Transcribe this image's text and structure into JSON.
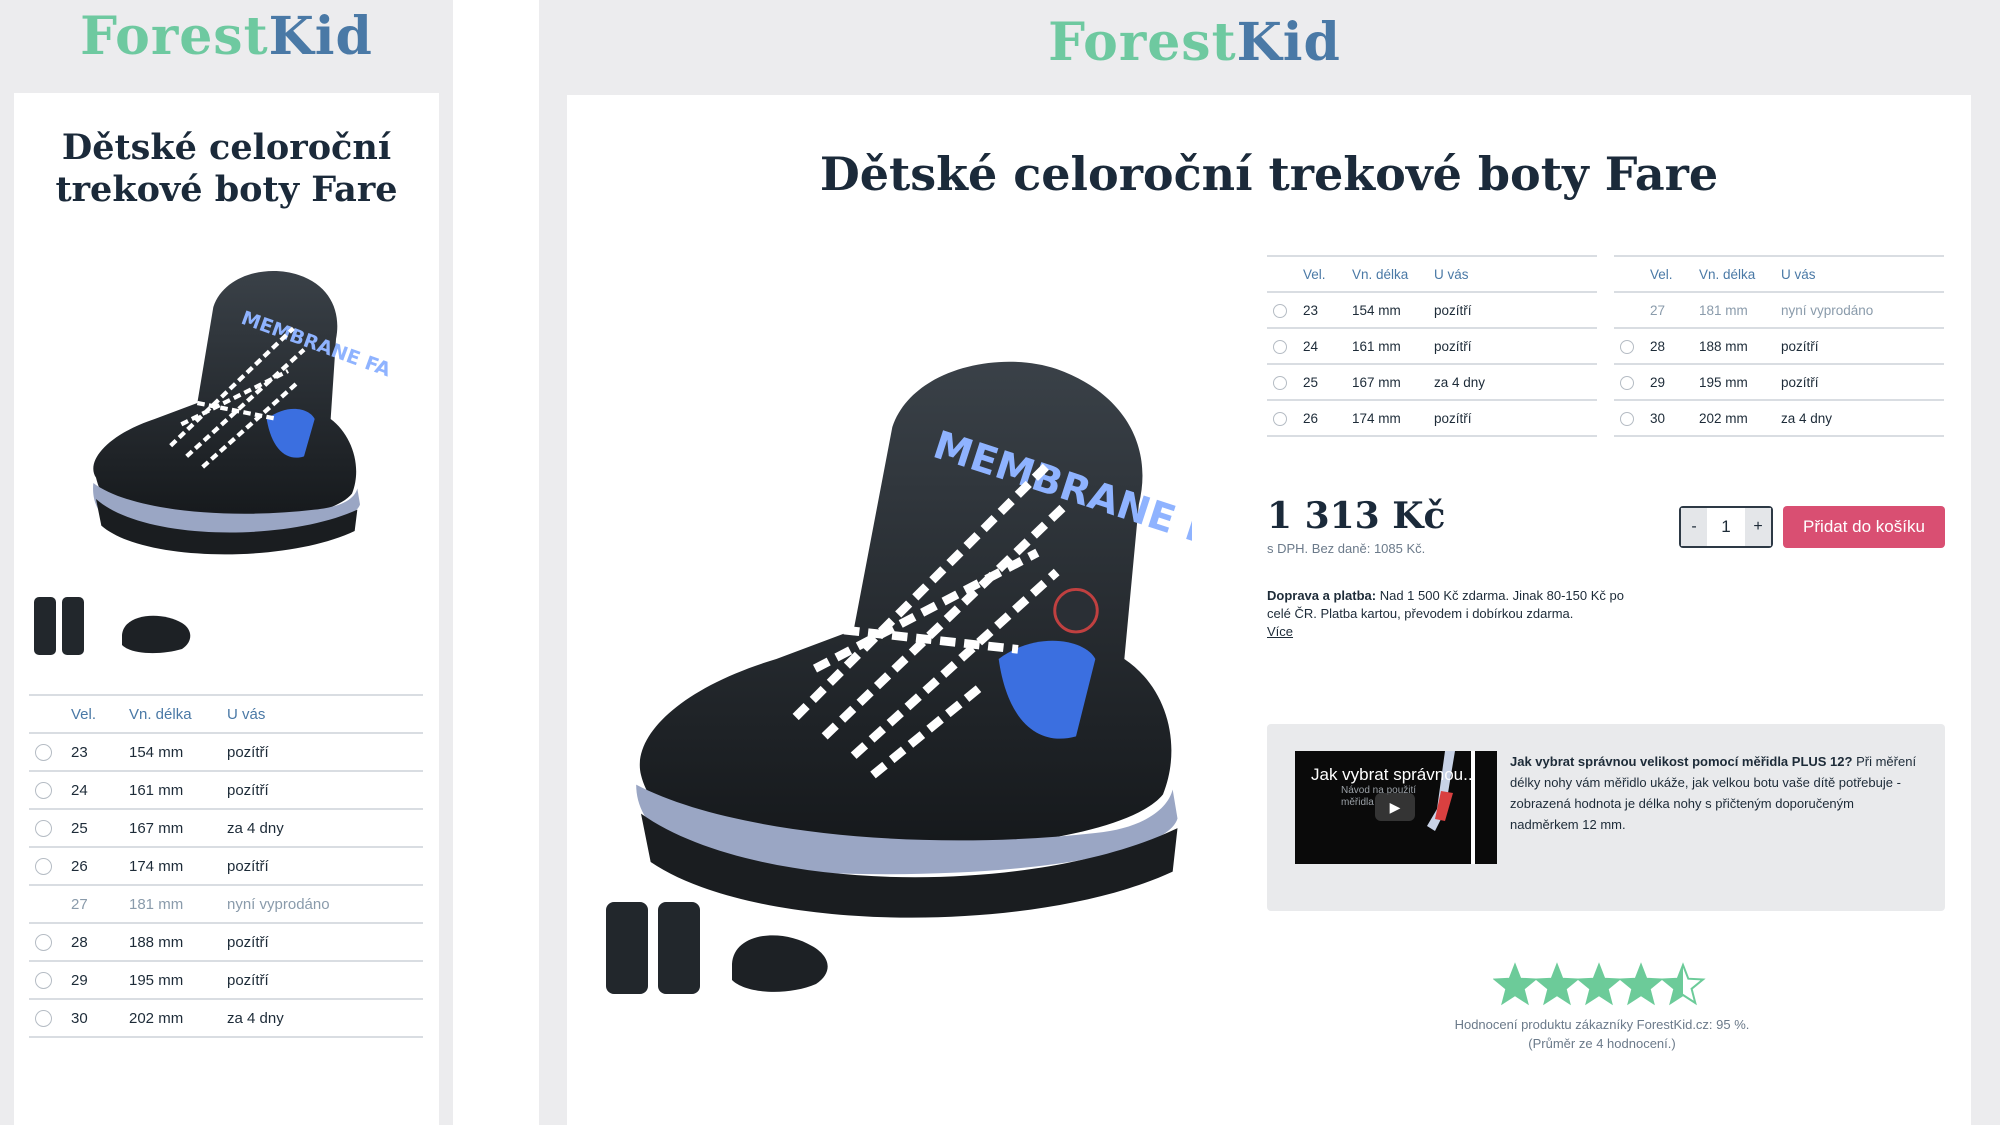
{
  "brand": {
    "part1": "Forest",
    "part2": "Kid"
  },
  "product": {
    "title": "Dětské celoroční trekové boty Fare",
    "title_mobile_line1": "Dětské celoroční",
    "title_mobile_line2": "trekové boty Fare",
    "shoe_print": "MEMBRANE FARE",
    "price": "1 313 Kč",
    "vat_note": "s DPH. Bez daně: 1085 Kč."
  },
  "size_table": {
    "headers": {
      "size": "Vel.",
      "length": "Vn. délka",
      "availability": "U vás"
    },
    "rows": [
      {
        "size": "23",
        "length": "154 mm",
        "availability": "pozítří",
        "sold_out": false
      },
      {
        "size": "24",
        "length": "161 mm",
        "availability": "pozítří",
        "sold_out": false
      },
      {
        "size": "25",
        "length": "167 mm",
        "availability": "za 4 dny",
        "sold_out": false
      },
      {
        "size": "26",
        "length": "174 mm",
        "availability": "pozítří",
        "sold_out": false
      },
      {
        "size": "27",
        "length": "181 mm",
        "availability": "nyní vyprodáno",
        "sold_out": true
      },
      {
        "size": "28",
        "length": "188 mm",
        "availability": "pozítří",
        "sold_out": false
      },
      {
        "size": "29",
        "length": "195 mm",
        "availability": "pozítří",
        "sold_out": false
      },
      {
        "size": "30",
        "length": "202 mm",
        "availability": "za 4 dny",
        "sold_out": false
      }
    ]
  },
  "cart": {
    "qty_minus": "-",
    "qty_value": "1",
    "qty_plus": "+",
    "add_label": "Přidat do košíku"
  },
  "shipping": {
    "label": "Doprava a platba:",
    "text": "Nad 1 500 Kč zdarma. Jinak 80-150 Kč po celé ČR. Platba kartou, převodem i dobírkou zdarma.",
    "more": "Více"
  },
  "video": {
    "thumb_title": "Jak vybrat správnou..",
    "thumb_sub": "Návod na použití měřidla",
    "heading": "Jak vybrat správnou velikost pomocí měřidla PLUS 12?",
    "text": "Při měření délky nohy vám měřidlo ukáže, jak velkou botu vaše dítě potřebuje - zobrazená hodnota je délka nohy s přičteným doporučeným nadměrkem 12 mm."
  },
  "rating": {
    "stars": 4.5,
    "max": 5,
    "line1": "Hodnocení produktu zákazníky ForestKid.cz: 95 %.",
    "line2": "(Průměr ze 4 hodnocení.)",
    "color": "#6ccb99"
  },
  "colors": {
    "accent": "#d94f72",
    "brand_green": "#6ec9a0",
    "brand_blue": "#4a79a6",
    "heading": "#1b2a3a"
  }
}
